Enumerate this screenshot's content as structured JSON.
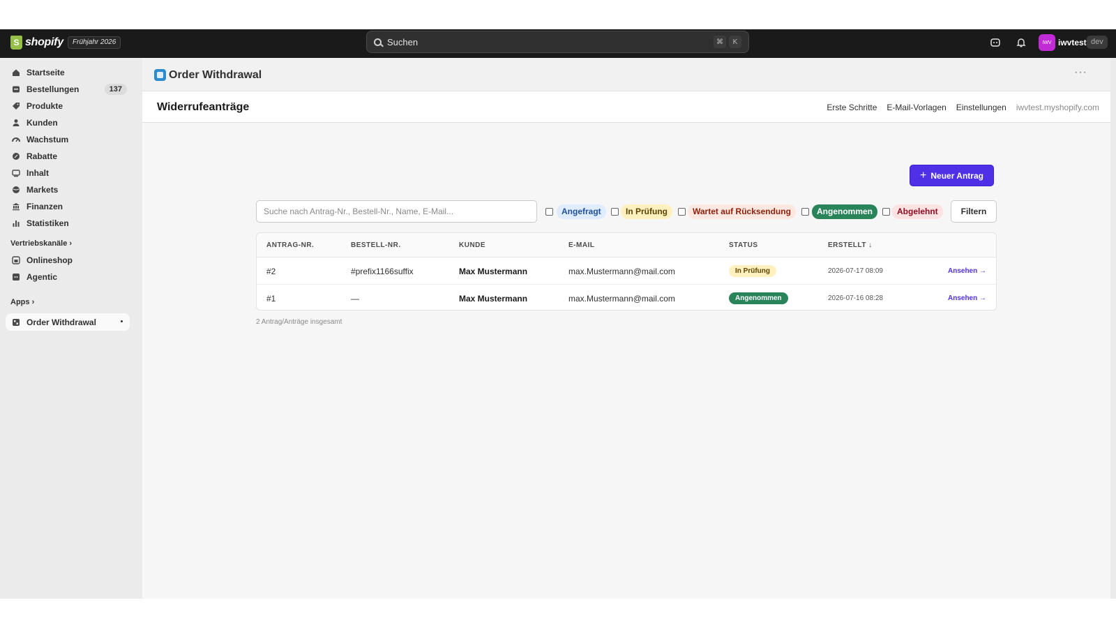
{
  "topbar": {
    "brand": "shopify",
    "brand_mark": "S",
    "edition": "Frühjahr 2026",
    "search_placeholder": "Suchen",
    "shortcut_cmd": "⌘",
    "shortcut_key": "K",
    "avatar_initials": "IWV",
    "store_name": "iwvtest",
    "env_badge": "dev"
  },
  "sidebar": {
    "items": [
      {
        "label": "Startseite",
        "icon": "home-icon"
      },
      {
        "label": "Bestellungen",
        "icon": "inbox-icon",
        "count": "137"
      },
      {
        "label": "Produkte",
        "icon": "tag-icon"
      },
      {
        "label": "Kunden",
        "icon": "person-icon"
      },
      {
        "label": "Wachstum",
        "icon": "gauge-icon"
      },
      {
        "label": "Rabatte",
        "icon": "discount-icon"
      },
      {
        "label": "Inhalt",
        "icon": "content-icon"
      },
      {
        "label": "Markets",
        "icon": "globe-icon"
      },
      {
        "label": "Finanzen",
        "icon": "bank-icon"
      },
      {
        "label": "Statistiken",
        "icon": "bar-chart-icon"
      }
    ],
    "sales_channels_label": "Vertriebskanäle",
    "channels": [
      {
        "label": "Onlineshop",
        "icon": "store-icon"
      },
      {
        "label": "Agentic",
        "icon": "agent-icon"
      }
    ],
    "apps_label": "Apps",
    "active_app": "Order Withdrawal"
  },
  "app": {
    "title": "Order Withdrawal",
    "more": "···"
  },
  "page": {
    "title": "Widerrufeanträge",
    "links": [
      "Erste Schritte",
      "E-Mail-Vorlagen",
      "Einstellungen"
    ],
    "domain": "iwvtest.myshopify.com",
    "new_button": "Neuer Antrag",
    "new_button_icon": "+"
  },
  "filters": {
    "search_placeholder": "Suche nach Antrag-Nr., Bestell-Nr., Name, E-Mail...",
    "statuses": [
      {
        "label": "Angefragt",
        "color": "#1f5199",
        "bg": "#e0ecff"
      },
      {
        "label": "In Prüfung",
        "color": "#5e4200",
        "bg": "#fff1bf"
      },
      {
        "label": "Wartet auf Rücksendung",
        "color": "#8e1f0b",
        "bg": "#fde8e1"
      },
      {
        "label": "Angenommen",
        "color": "#ffffff",
        "bg": "#29845a"
      },
      {
        "label": "Abgelehnt",
        "color": "#8e0b21",
        "bg": "#fde2e2"
      }
    ],
    "filter_button": "Filtern"
  },
  "table": {
    "headers": [
      "ANTRAG-NR.",
      "BESTELL-NR.",
      "KUNDE",
      "E-MAIL",
      "STATUS",
      "ERSTELLT ↓"
    ],
    "rows": [
      {
        "id": "#2",
        "order": "#prefix1166suffix",
        "customer": "Max Mustermann",
        "email": "max.Mustermann@mail.com",
        "status": "In Prüfung",
        "status_color": "#5e4200",
        "status_bg": "#fff1bf",
        "created": "2026-07-17 08:09",
        "action": "Ansehen →"
      },
      {
        "id": "#1",
        "order": "—",
        "customer": "Max Mustermann",
        "email": "max.Mustermann@mail.com",
        "status": "Angenommen",
        "status_color": "#ffffff",
        "status_bg": "#29845a",
        "created": "2026-07-16 08:28",
        "action": "Ansehen →"
      }
    ],
    "total": "2 Antrag/Anträge insgesamt"
  },
  "colors": {
    "accent": "#4f30e6",
    "topbar": "#1a1a1a",
    "sidebar": "#ebebeb"
  }
}
